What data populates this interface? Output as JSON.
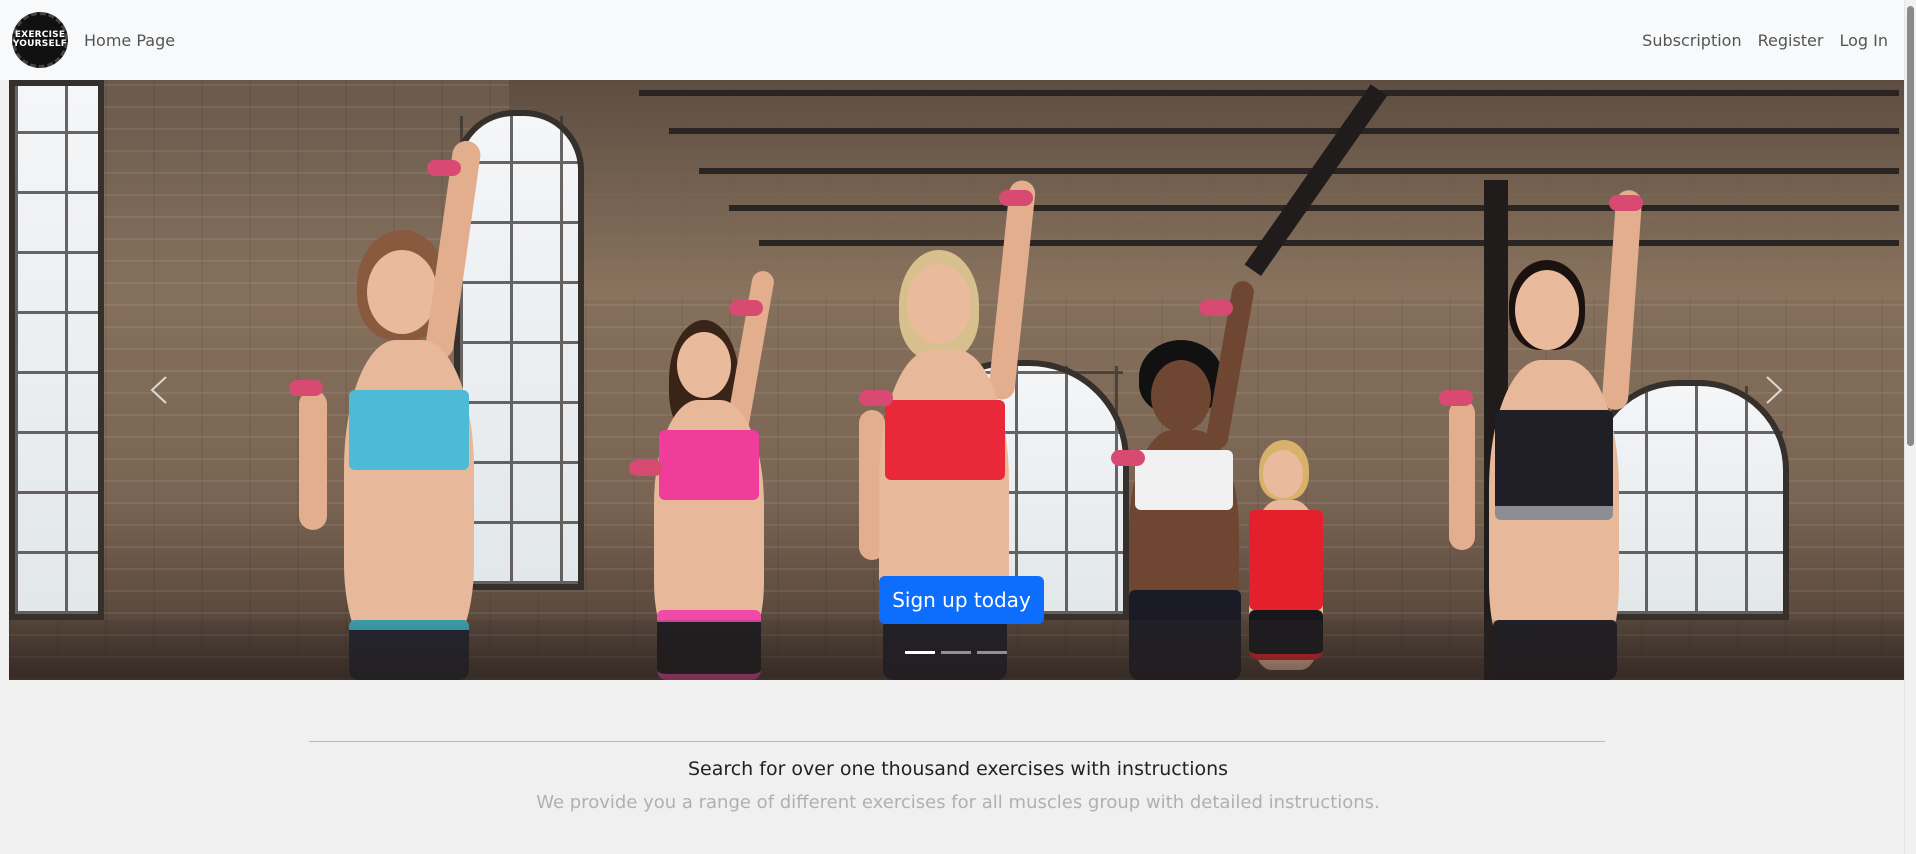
{
  "navbar": {
    "logo_text": "EXERCISE YOURSELF",
    "home_label": "Home Page",
    "links": [
      {
        "label": "Subscription"
      },
      {
        "label": "Register"
      },
      {
        "label": "Log In"
      }
    ]
  },
  "carousel": {
    "cta_label": "Sign up today",
    "slide_count": 3,
    "active_index": 0,
    "prev_icon": "chevron-left-icon",
    "next_icon": "chevron-right-icon"
  },
  "section": {
    "heading": "Search for over one thousand exercises with instructions",
    "subheading": "We provide you a range of different exercises for all muscles group with detailed instructions."
  },
  "colors": {
    "primary": "#0d6efd",
    "navbar_bg": "#f8f9fa",
    "page_bg": "#f0f0f0",
    "muted_text": "#b0b0b0"
  }
}
